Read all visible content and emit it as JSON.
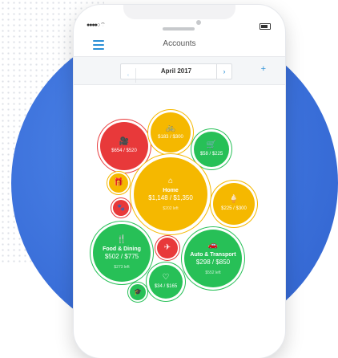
{
  "header": {
    "title": "Accounts"
  },
  "date_nav": {
    "prev": "‹",
    "month": "April 2017",
    "next": "›",
    "add": "+"
  },
  "bubbles": {
    "dining_out": {
      "amount": "$654 / $520",
      "icon": "camera-icon"
    },
    "bikes": {
      "amount": "$183 / $300",
      "icon": "bicycle-icon"
    },
    "shopping": {
      "amount": "$58 / $225",
      "icon": "cart-icon"
    },
    "gifts": {
      "icon": "gift-icon"
    },
    "home": {
      "label": "Home",
      "amount": "$1,148 / $1,350",
      "left": "$202 left",
      "icon": "house-icon"
    },
    "ice_cream": {
      "amount": "$225 / $300",
      "icon": "ice-cream-icon"
    },
    "pets": {
      "icon": "paw-icon"
    },
    "food_dining": {
      "label": "Food & Dining",
      "amount": "$502 / $775",
      "left": "$273 left",
      "icon": "utensils-icon"
    },
    "travel": {
      "icon": "plane-icon"
    },
    "auto": {
      "label": "Auto & Transport",
      "amount": "$298 / $850",
      "left": "$552 left",
      "icon": "car-icon"
    },
    "health": {
      "amount": "$34 / $165",
      "icon": "heartbeat-icon"
    },
    "education": {
      "icon": "graduation-cap-icon"
    }
  },
  "colors": {
    "red": "#e8393a",
    "yellow": "#f5b800",
    "green": "#27c057",
    "blue": "#3a6fd9",
    "accent": "#2a8fd6"
  }
}
